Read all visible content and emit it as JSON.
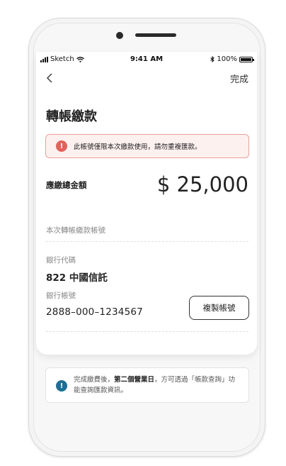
{
  "status_bar": {
    "carrier": "Sketch",
    "time": "9:41 AM",
    "battery_pct": "100%"
  },
  "nav": {
    "done_label": "完成"
  },
  "page": {
    "title": "轉帳繳款"
  },
  "alert": {
    "icon": "exclamation-icon",
    "text": "此帳號僅限本次繳款使用，請勿重複匯款。",
    "color": "#e0635b"
  },
  "total": {
    "label": "應繳總金額",
    "amount": "$ 25,000"
  },
  "account": {
    "section_title": "本次轉帳繳款帳號",
    "bank_code_label": "銀行代碼",
    "bank_code_value": "822 中國信託",
    "bank_account_label": "銀行帳號",
    "bank_account_value": "2888–000–1234567",
    "copy_button_label": "複製帳號"
  },
  "info": {
    "icon": "info-icon",
    "text_before": "完成繳費後，",
    "text_bold": "第二個營業日",
    "text_after": "，方可透過「帳款查詢」功能查詢匯款資訊。",
    "color": "#1e6f96"
  }
}
